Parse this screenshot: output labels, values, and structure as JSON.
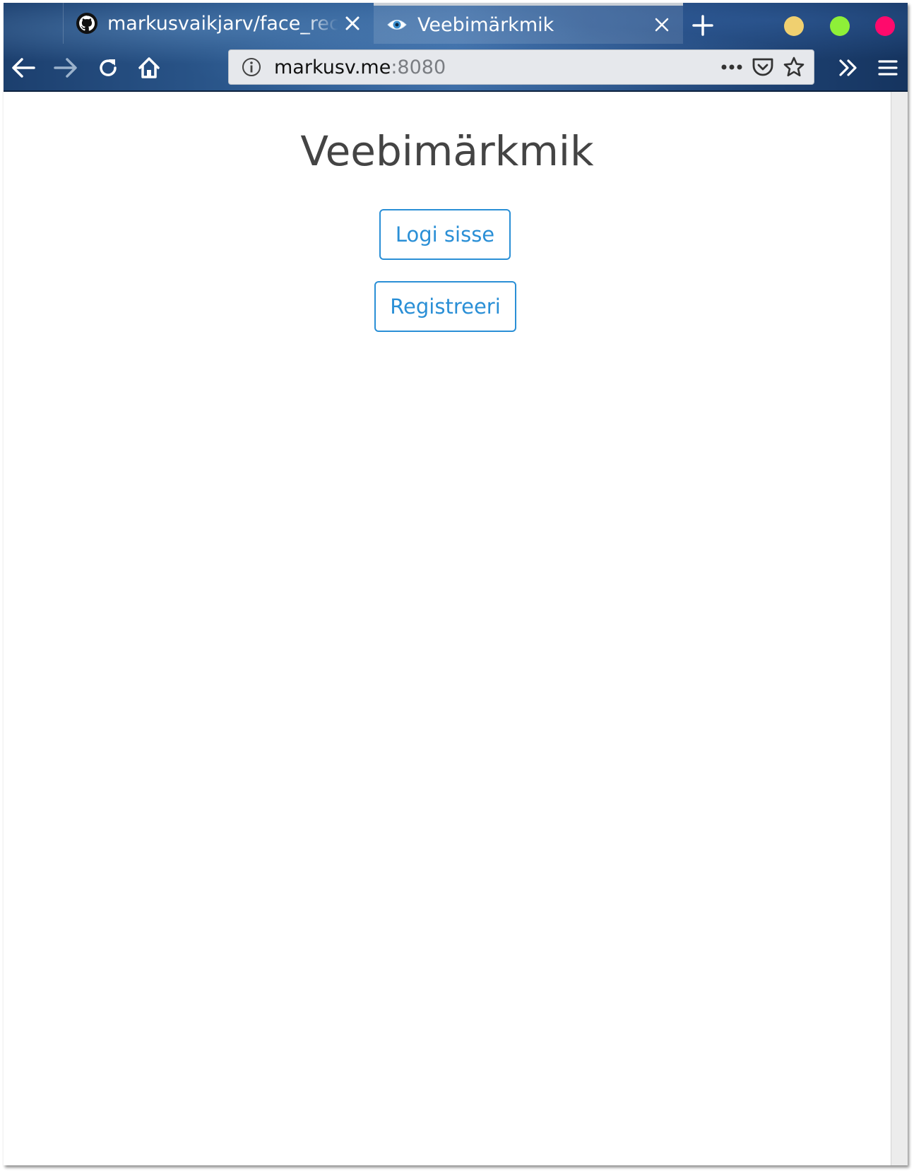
{
  "browser": {
    "tabs": [
      {
        "title": "markusvaikjarv/face_recognition",
        "icon": "github-icon",
        "active": false
      },
      {
        "title": "Veebimärkmik",
        "icon": "eye-icon",
        "active": true
      }
    ],
    "url": {
      "host": "markusv.me",
      "port": ":8080"
    },
    "window_buttons": {
      "minimize_color": "#f0d070",
      "maximize_color": "#8ef038",
      "close_color": "#ff0a6c"
    }
  },
  "page": {
    "title": "Veebimärkmik",
    "login_label": "Logi sisse",
    "register_label": "Registreeri"
  },
  "colors": {
    "accent": "#2a8fd6",
    "heading": "#444444"
  }
}
